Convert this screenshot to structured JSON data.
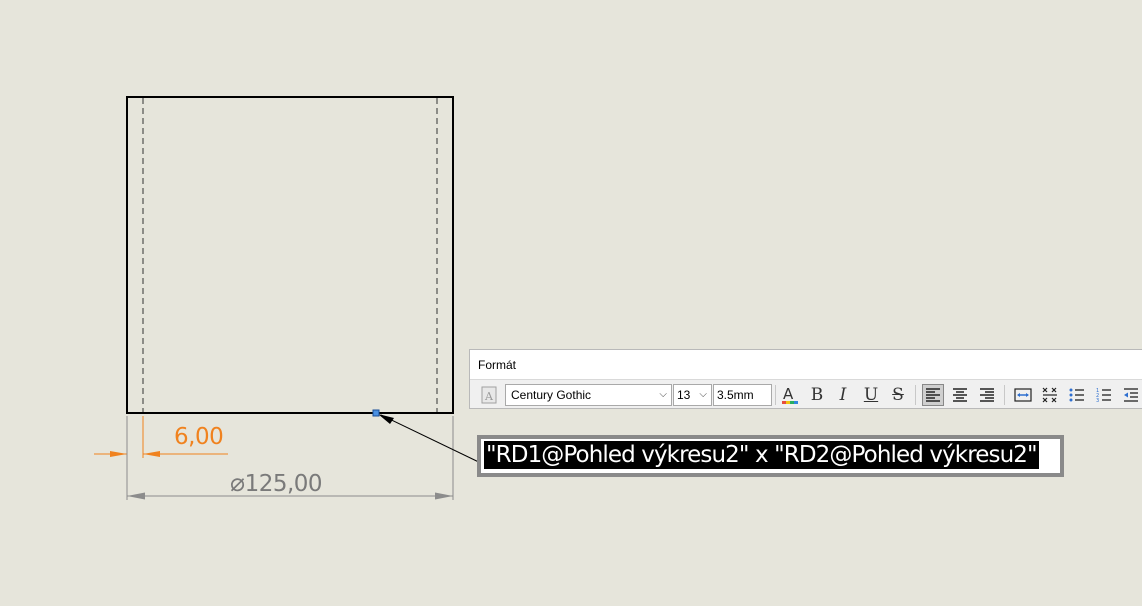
{
  "drawing": {
    "dimension_wall": "6,00",
    "dimension_diameter_symbol": "⌀",
    "dimension_diameter": "125,00"
  },
  "format_toolbar": {
    "title": "Formát",
    "font_name": "Century Gothic",
    "font_size": "13",
    "text_height": "3.5mm",
    "buttons": {
      "style_icon": "style-a-icon",
      "font_color": "A",
      "bold": "B",
      "italic": "I",
      "underline": "U",
      "strikethrough": "S"
    }
  },
  "note": {
    "text": "\"RD1@Pohled výkresu2\" x \"RD2@Pohled výkresu2\""
  },
  "colors": {
    "background": "#e6e5db",
    "dimension_orange": "#f0821e",
    "dimension_gray": "#7a7a7a",
    "selection_highlight": "#000000"
  }
}
